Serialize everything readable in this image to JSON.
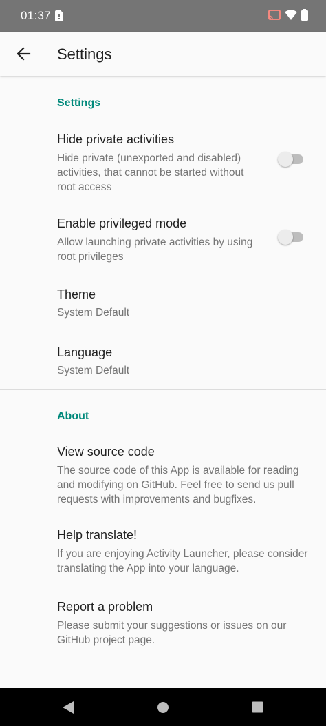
{
  "status_bar": {
    "time": "01:37",
    "icons": [
      "sim-card-icon",
      "cast-icon",
      "wifi-icon",
      "battery-icon"
    ]
  },
  "app_bar": {
    "title": "Settings",
    "back_icon": "arrow-back-icon"
  },
  "sections": {
    "settings": {
      "header": "Settings",
      "hide_private": {
        "title": "Hide private activities",
        "summary": "Hide private (unexported and disabled) activities, that cannot be started without root access",
        "enabled": false
      },
      "privileged_mode": {
        "title": "Enable privileged mode",
        "summary": "Allow launching private activities by using root privileges",
        "enabled": false
      },
      "theme": {
        "title": "Theme",
        "summary": "System Default"
      },
      "language": {
        "title": "Language",
        "summary": "System Default"
      }
    },
    "about": {
      "header": "About",
      "source_code": {
        "title": "View source code",
        "summary": "The source code of this App is available for reading and modifying on GitHub. Feel free to send us pull requests with improvements and bugfixes."
      },
      "translate": {
        "title": "Help translate!",
        "summary": "If you are enjoying Activity Launcher, please consider translating the App into your language."
      },
      "report": {
        "title": "Report a problem",
        "summary": "Please submit your suggestions or issues on our GitHub project page."
      }
    }
  },
  "nav_bar": {
    "icons": [
      "back-triangle-icon",
      "home-circle-icon",
      "recents-square-icon"
    ]
  },
  "colors": {
    "status_bar": "#757575",
    "accent": "#00897b",
    "background": "#fafafa",
    "title_text": "#212121",
    "summary_text": "#757575"
  }
}
